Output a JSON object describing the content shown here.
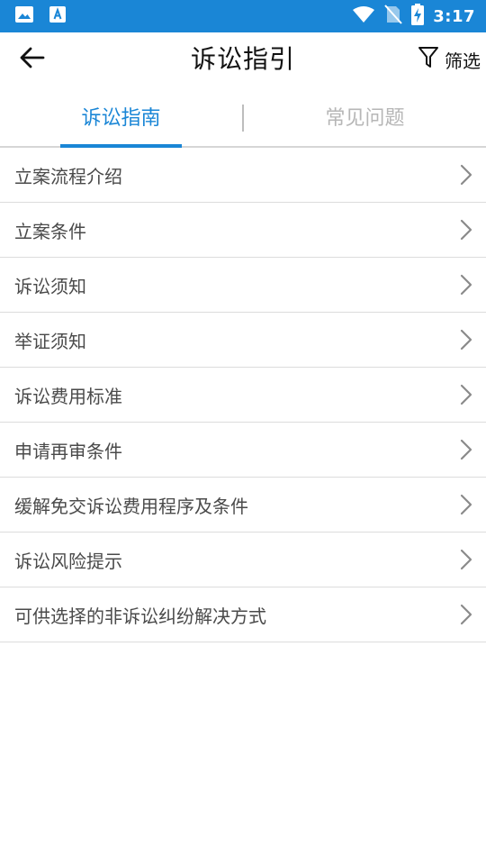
{
  "status_bar": {
    "time": "3:17",
    "icons": [
      "image-notification-icon",
      "app-notification-icon",
      "wifi-icon",
      "no-sim-icon",
      "battery-charging-icon"
    ]
  },
  "header": {
    "title": "诉讼指引",
    "filter_label": "筛选",
    "back_icon": "arrow-left-icon",
    "filter_icon": "funnel-icon"
  },
  "tabs": [
    {
      "label": "诉讼指南",
      "active": true
    },
    {
      "label": "常见问题",
      "active": false
    }
  ],
  "list": {
    "items": [
      {
        "label": "立案流程介绍"
      },
      {
        "label": "立案条件"
      },
      {
        "label": "诉讼须知"
      },
      {
        "label": "举证须知"
      },
      {
        "label": "诉讼费用标准"
      },
      {
        "label": "申请再审条件"
      },
      {
        "label": "缓解免交诉讼费用程序及条件"
      },
      {
        "label": "诉讼风险提示"
      },
      {
        "label": "可供选择的非诉讼纠纷解决方式"
      }
    ]
  },
  "colors": {
    "accent": "#1a86d6",
    "inactive_tab": "#b6b6b6",
    "divider": "#dcdcdc",
    "item_text": "#4a4a4a",
    "chevron": "#8a8a8a"
  }
}
